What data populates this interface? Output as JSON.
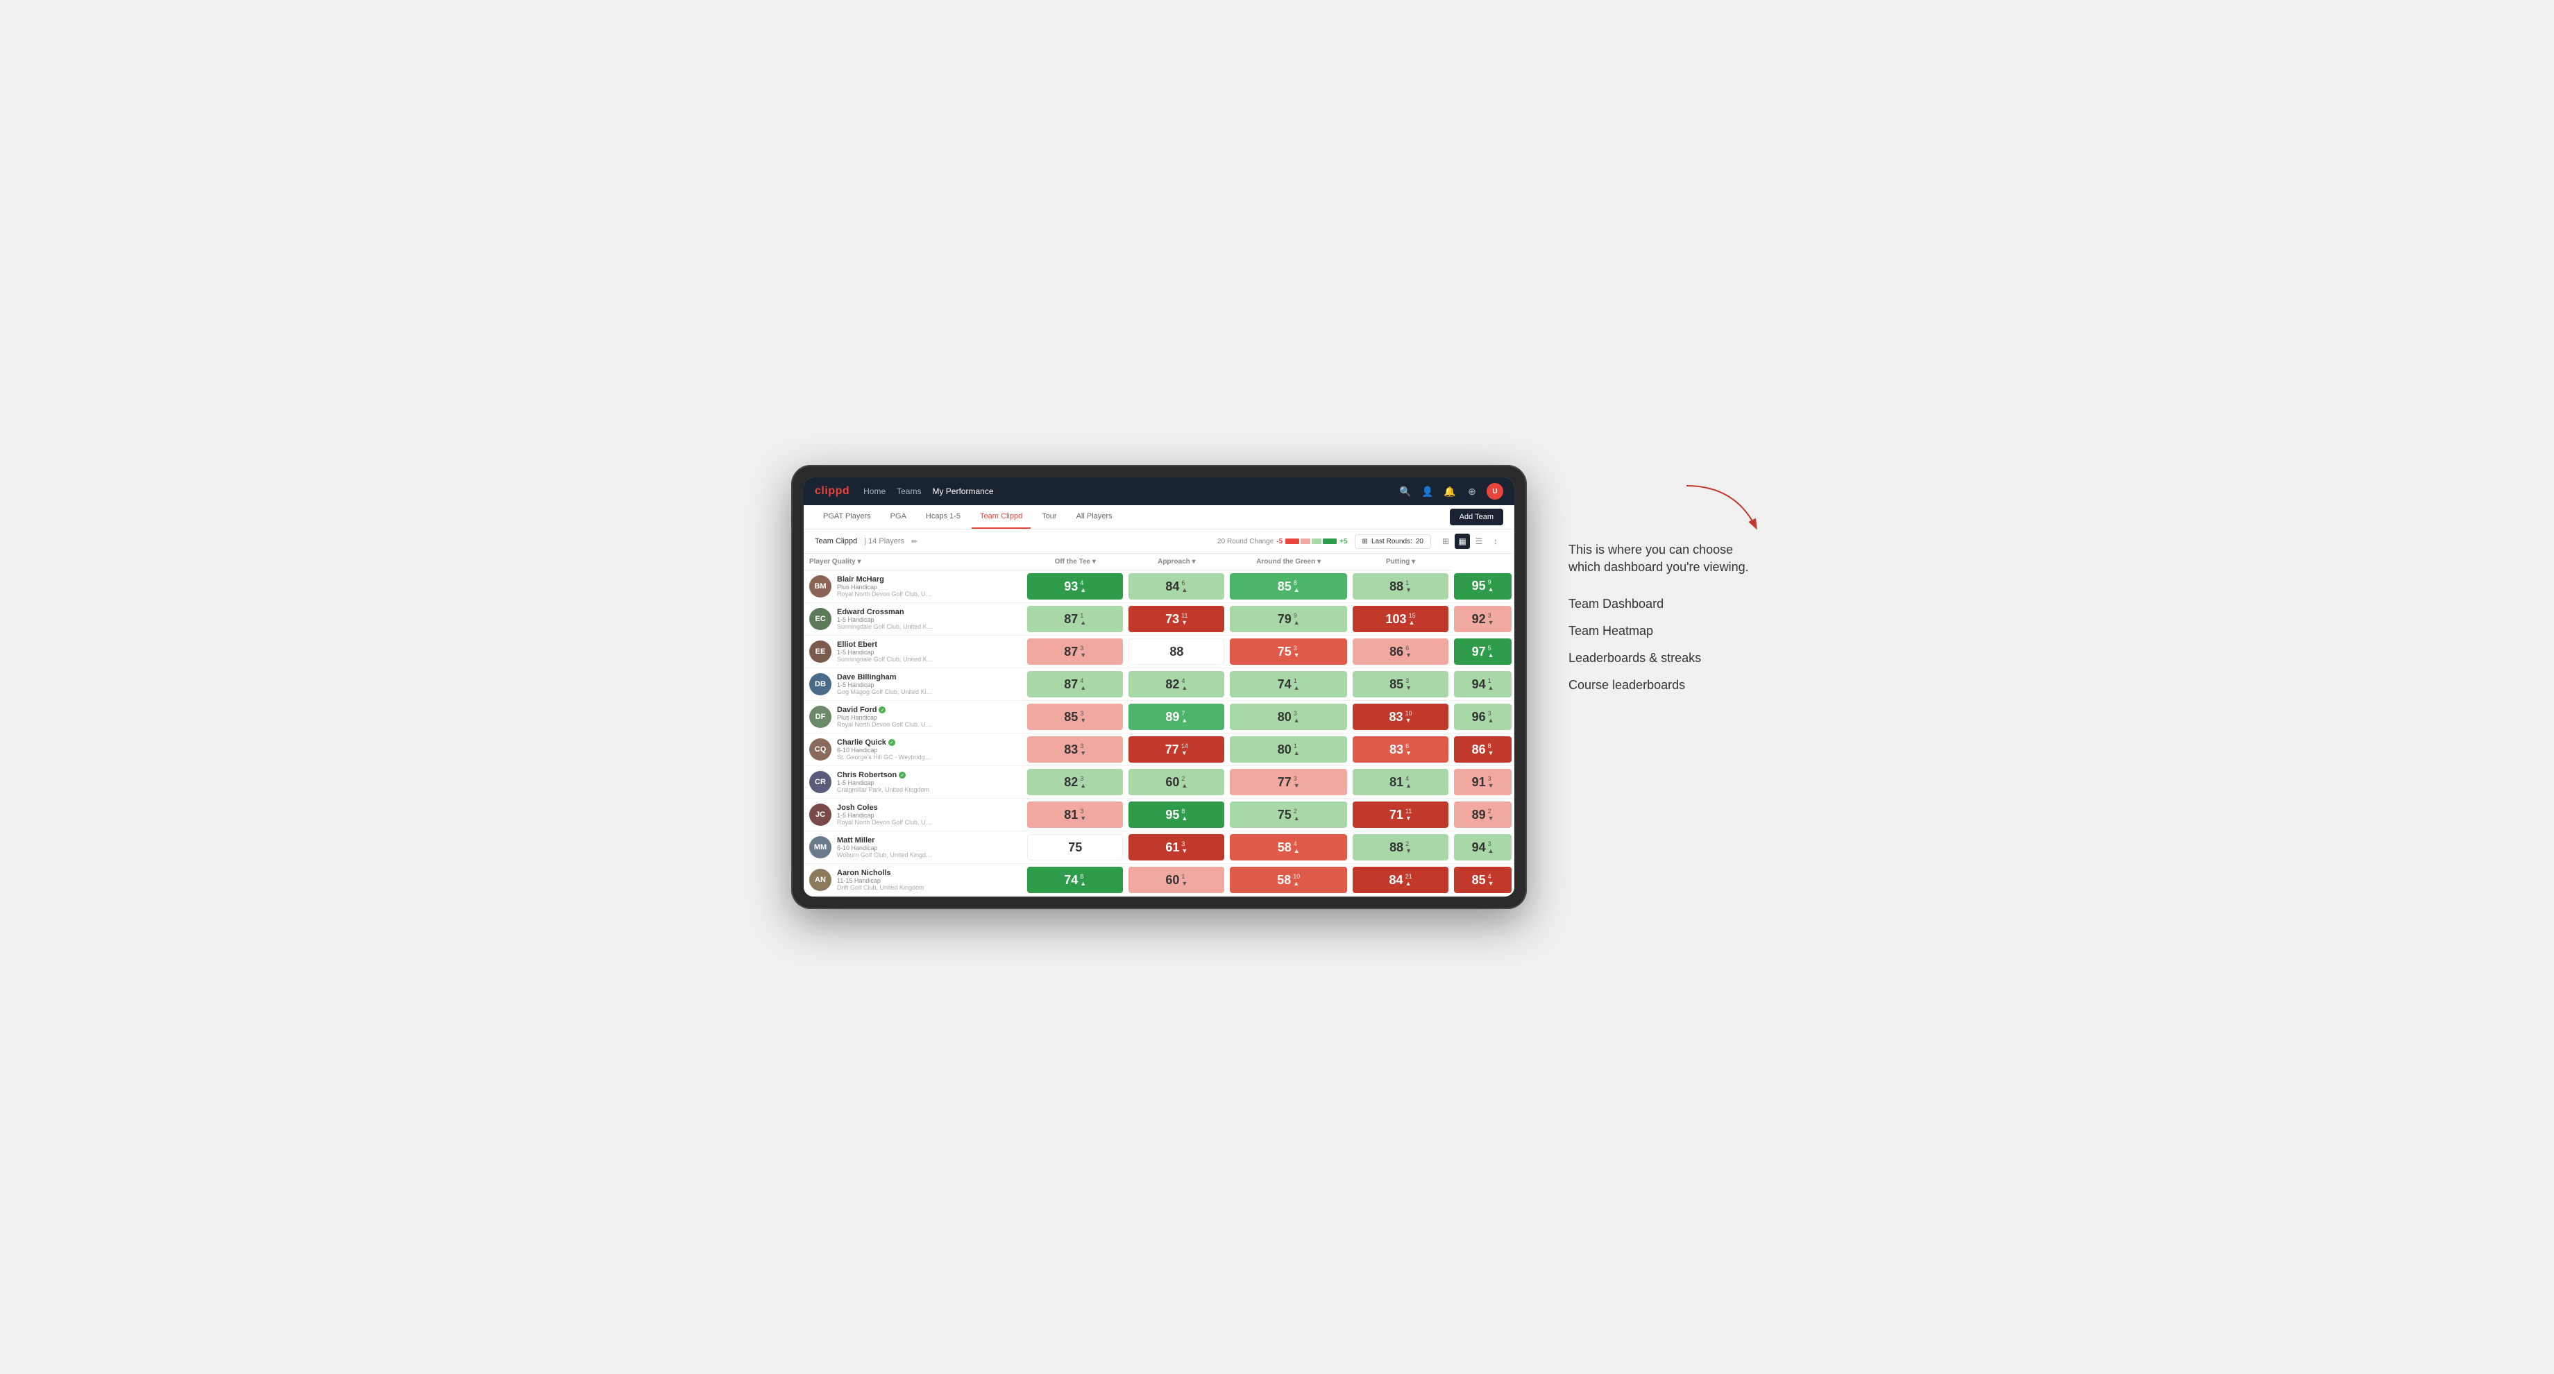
{
  "annotation": {
    "intro_text": "This is where you can choose which dashboard you're viewing.",
    "items": [
      "Team Dashboard",
      "Team Heatmap",
      "Leaderboards & streaks",
      "Course leaderboards"
    ]
  },
  "nav": {
    "logo": "clippd",
    "links": [
      {
        "label": "Home",
        "active": false
      },
      {
        "label": "Teams",
        "active": false
      },
      {
        "label": "My Performance",
        "active": true
      }
    ],
    "icons": [
      "search",
      "person",
      "bell",
      "circle-plus",
      "avatar"
    ]
  },
  "sub_nav": {
    "items": [
      {
        "label": "PGAT Players",
        "active": false
      },
      {
        "label": "PGA",
        "active": false
      },
      {
        "label": "Hcaps 1-5",
        "active": false
      },
      {
        "label": "Team Clippd",
        "active": true
      },
      {
        "label": "Tour",
        "active": false
      },
      {
        "label": "All Players",
        "active": false
      }
    ],
    "add_team_label": "Add Team"
  },
  "toolbar": {
    "team_name": "Team Clippd",
    "separator": "|",
    "player_count": "14 Players",
    "round_change_label": "20 Round Change",
    "change_neg": "-5",
    "change_pos": "+5",
    "last_rounds_label": "Last Rounds:",
    "last_rounds_value": "20"
  },
  "table": {
    "col_headers": [
      {
        "label": "Player Quality ▾",
        "align": "left"
      },
      {
        "label": "Off the Tee ▾",
        "align": "center"
      },
      {
        "label": "Approach ▾",
        "align": "center"
      },
      {
        "label": "Around the Green ▾",
        "align": "center"
      },
      {
        "label": "Putting ▾",
        "align": "center"
      }
    ],
    "players": [
      {
        "name": "Blair McHarg",
        "handicap": "Plus Handicap",
        "club": "Royal North Devon Golf Club, United Kingdom",
        "avatar_color": "#8B7355",
        "initials": "BM",
        "metrics": [
          {
            "score": "93",
            "change": "4",
            "dir": "up",
            "color": "green-dark"
          },
          {
            "score": "84",
            "change": "6",
            "dir": "up",
            "color": "green-light"
          },
          {
            "score": "85",
            "change": "8",
            "dir": "up",
            "color": "green-med"
          },
          {
            "score": "88",
            "change": "1",
            "dir": "down",
            "color": "green-light"
          },
          {
            "score": "95",
            "change": "9",
            "dir": "up",
            "color": "green-dark"
          }
        ]
      },
      {
        "name": "Edward Crossman",
        "handicap": "1-5 Handicap",
        "club": "Sunningdale Golf Club, United Kingdom",
        "avatar_color": "#5a7a5a",
        "initials": "EC",
        "metrics": [
          {
            "score": "87",
            "change": "1",
            "dir": "up",
            "color": "green-light"
          },
          {
            "score": "73",
            "change": "11",
            "dir": "down",
            "color": "red-dark"
          },
          {
            "score": "79",
            "change": "9",
            "dir": "up",
            "color": "green-light"
          },
          {
            "score": "103",
            "change": "15",
            "dir": "up",
            "color": "red-dark"
          },
          {
            "score": "92",
            "change": "3",
            "dir": "down",
            "color": "red-light"
          }
        ]
      },
      {
        "name": "Elliot Ebert",
        "handicap": "1-5 Handicap",
        "club": "Sunningdale Golf Club, United Kingdom",
        "avatar_color": "#7a5a4a",
        "initials": "EE",
        "metrics": [
          {
            "score": "87",
            "change": "3",
            "dir": "down",
            "color": "red-light"
          },
          {
            "score": "88",
            "change": "",
            "dir": "",
            "color": "white"
          },
          {
            "score": "75",
            "change": "3",
            "dir": "down",
            "color": "red-med"
          },
          {
            "score": "86",
            "change": "6",
            "dir": "down",
            "color": "red-light"
          },
          {
            "score": "97",
            "change": "5",
            "dir": "up",
            "color": "green-dark"
          }
        ]
      },
      {
        "name": "Dave Billingham",
        "handicap": "1-5 Handicap",
        "club": "Gog Magog Golf Club, United Kingdom",
        "avatar_color": "#4a6a8a",
        "initials": "DB",
        "metrics": [
          {
            "score": "87",
            "change": "4",
            "dir": "up",
            "color": "green-light"
          },
          {
            "score": "82",
            "change": "4",
            "dir": "up",
            "color": "green-light"
          },
          {
            "score": "74",
            "change": "1",
            "dir": "up",
            "color": "green-light"
          },
          {
            "score": "85",
            "change": "3",
            "dir": "down",
            "color": "green-light"
          },
          {
            "score": "94",
            "change": "1",
            "dir": "up",
            "color": "green-light"
          }
        ]
      },
      {
        "name": "David Ford",
        "handicap": "Plus Handicap",
        "club": "Royal North Devon Golf Club, United Kingdom",
        "avatar_color": "#6a8a6a",
        "initials": "DF",
        "verified": true,
        "metrics": [
          {
            "score": "85",
            "change": "3",
            "dir": "down",
            "color": "red-light"
          },
          {
            "score": "89",
            "change": "7",
            "dir": "up",
            "color": "green-med"
          },
          {
            "score": "80",
            "change": "3",
            "dir": "up",
            "color": "green-light"
          },
          {
            "score": "83",
            "change": "10",
            "dir": "down",
            "color": "red-dark"
          },
          {
            "score": "96",
            "change": "3",
            "dir": "up",
            "color": "green-light"
          }
        ]
      },
      {
        "name": "Charlie Quick",
        "handicap": "6-10 Handicap",
        "club": "St. George's Hill GC - Weybridge - Surrey, Uni...",
        "avatar_color": "#8a6a5a",
        "initials": "CQ",
        "verified": true,
        "metrics": [
          {
            "score": "83",
            "change": "3",
            "dir": "down",
            "color": "red-light"
          },
          {
            "score": "77",
            "change": "14",
            "dir": "down",
            "color": "red-dark"
          },
          {
            "score": "80",
            "change": "1",
            "dir": "up",
            "color": "green-light"
          },
          {
            "score": "83",
            "change": "6",
            "dir": "down",
            "color": "red-med"
          },
          {
            "score": "86",
            "change": "8",
            "dir": "down",
            "color": "red-dark"
          }
        ]
      },
      {
        "name": "Chris Robertson",
        "handicap": "1-5 Handicap",
        "club": "Craigmillar Park, United Kingdom",
        "avatar_color": "#5a5a7a",
        "initials": "CR",
        "verified": true,
        "metrics": [
          {
            "score": "82",
            "change": "3",
            "dir": "up",
            "color": "green-light"
          },
          {
            "score": "60",
            "change": "2",
            "dir": "up",
            "color": "green-light"
          },
          {
            "score": "77",
            "change": "3",
            "dir": "down",
            "color": "red-light"
          },
          {
            "score": "81",
            "change": "4",
            "dir": "up",
            "color": "green-light"
          },
          {
            "score": "91",
            "change": "3",
            "dir": "down",
            "color": "red-light"
          }
        ]
      },
      {
        "name": "Josh Coles",
        "handicap": "1-5 Handicap",
        "club": "Royal North Devon Golf Club, United Kingdom",
        "avatar_color": "#7a4a4a",
        "initials": "JC",
        "metrics": [
          {
            "score": "81",
            "change": "3",
            "dir": "down",
            "color": "red-light"
          },
          {
            "score": "95",
            "change": "8",
            "dir": "up",
            "color": "green-dark"
          },
          {
            "score": "75",
            "change": "2",
            "dir": "up",
            "color": "green-light"
          },
          {
            "score": "71",
            "change": "11",
            "dir": "down",
            "color": "red-dark"
          },
          {
            "score": "89",
            "change": "2",
            "dir": "down",
            "color": "red-light"
          }
        ]
      },
      {
        "name": "Matt Miller",
        "handicap": "6-10 Handicap",
        "club": "Woburn Golf Club, United Kingdom",
        "avatar_color": "#6a7a8a",
        "initials": "MM",
        "metrics": [
          {
            "score": "75",
            "change": "",
            "dir": "",
            "color": "white"
          },
          {
            "score": "61",
            "change": "3",
            "dir": "down",
            "color": "red-dark"
          },
          {
            "score": "58",
            "change": "4",
            "dir": "up",
            "color": "red-med"
          },
          {
            "score": "88",
            "change": "2",
            "dir": "down",
            "color": "green-light"
          },
          {
            "score": "94",
            "change": "3",
            "dir": "up",
            "color": "green-light"
          }
        ]
      },
      {
        "name": "Aaron Nicholls",
        "handicap": "11-15 Handicap",
        "club": "Drift Golf Club, United Kingdom",
        "avatar_color": "#8a7a5a",
        "initials": "AN",
        "metrics": [
          {
            "score": "74",
            "change": "8",
            "dir": "up",
            "color": "green-dark"
          },
          {
            "score": "60",
            "change": "1",
            "dir": "down",
            "color": "red-light"
          },
          {
            "score": "58",
            "change": "10",
            "dir": "up",
            "color": "red-med"
          },
          {
            "score": "84",
            "change": "21",
            "dir": "up",
            "color": "red-dark"
          },
          {
            "score": "85",
            "change": "4",
            "dir": "down",
            "color": "red-dark"
          }
        ]
      }
    ]
  }
}
